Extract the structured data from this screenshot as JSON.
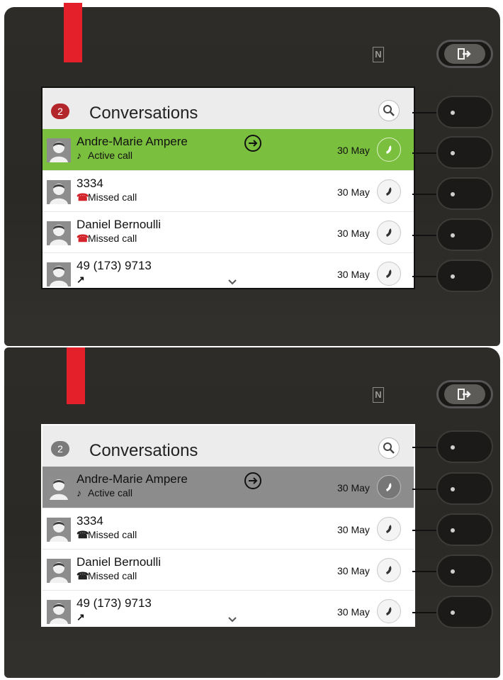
{
  "colors": {
    "led": "#e4202a",
    "active_row_top": "#7bbf3e",
    "active_row_bottom": "#8c8c8c",
    "badge_top": "#b3262c",
    "badge_bottom": "#7a7a7a",
    "missed_icon_top": "#d2222a",
    "missed_icon_bottom": "#222222"
  },
  "nfc_label": "N",
  "screens": [
    {
      "badge": "2",
      "title": "Conversations",
      "rows": [
        {
          "name": "Andre-Marie Ampere",
          "status": "Active call",
          "status_icon": "handset-icon",
          "date": "30 May",
          "active": true,
          "has_forward": true
        },
        {
          "name": "3334",
          "status": "Missed call",
          "status_icon": "missed-call-icon",
          "date": "30 May"
        },
        {
          "name": "Daniel Bernoulli",
          "status": "Missed call",
          "status_icon": "missed-call-icon",
          "date": "30 May"
        },
        {
          "name": "49 (173) 9713",
          "status": "",
          "status_icon": "outgoing-call-icon",
          "date": "30 May"
        }
      ]
    },
    {
      "badge": "2",
      "title": "Conversations",
      "rows": [
        {
          "name": "Andre-Marie Ampere",
          "status": "Active call",
          "status_icon": "handset-icon",
          "date": "30 May",
          "active": true,
          "has_forward": true
        },
        {
          "name": "3334",
          "status": "Missed call",
          "status_icon": "missed-call-icon",
          "date": "30 May"
        },
        {
          "name": "Daniel Bernoulli",
          "status": "Missed call",
          "status_icon": "missed-call-icon",
          "date": "30 May"
        },
        {
          "name": "49 (173) 9713",
          "status": "",
          "status_icon": "outgoing-call-icon",
          "date": "30 May"
        }
      ]
    }
  ]
}
